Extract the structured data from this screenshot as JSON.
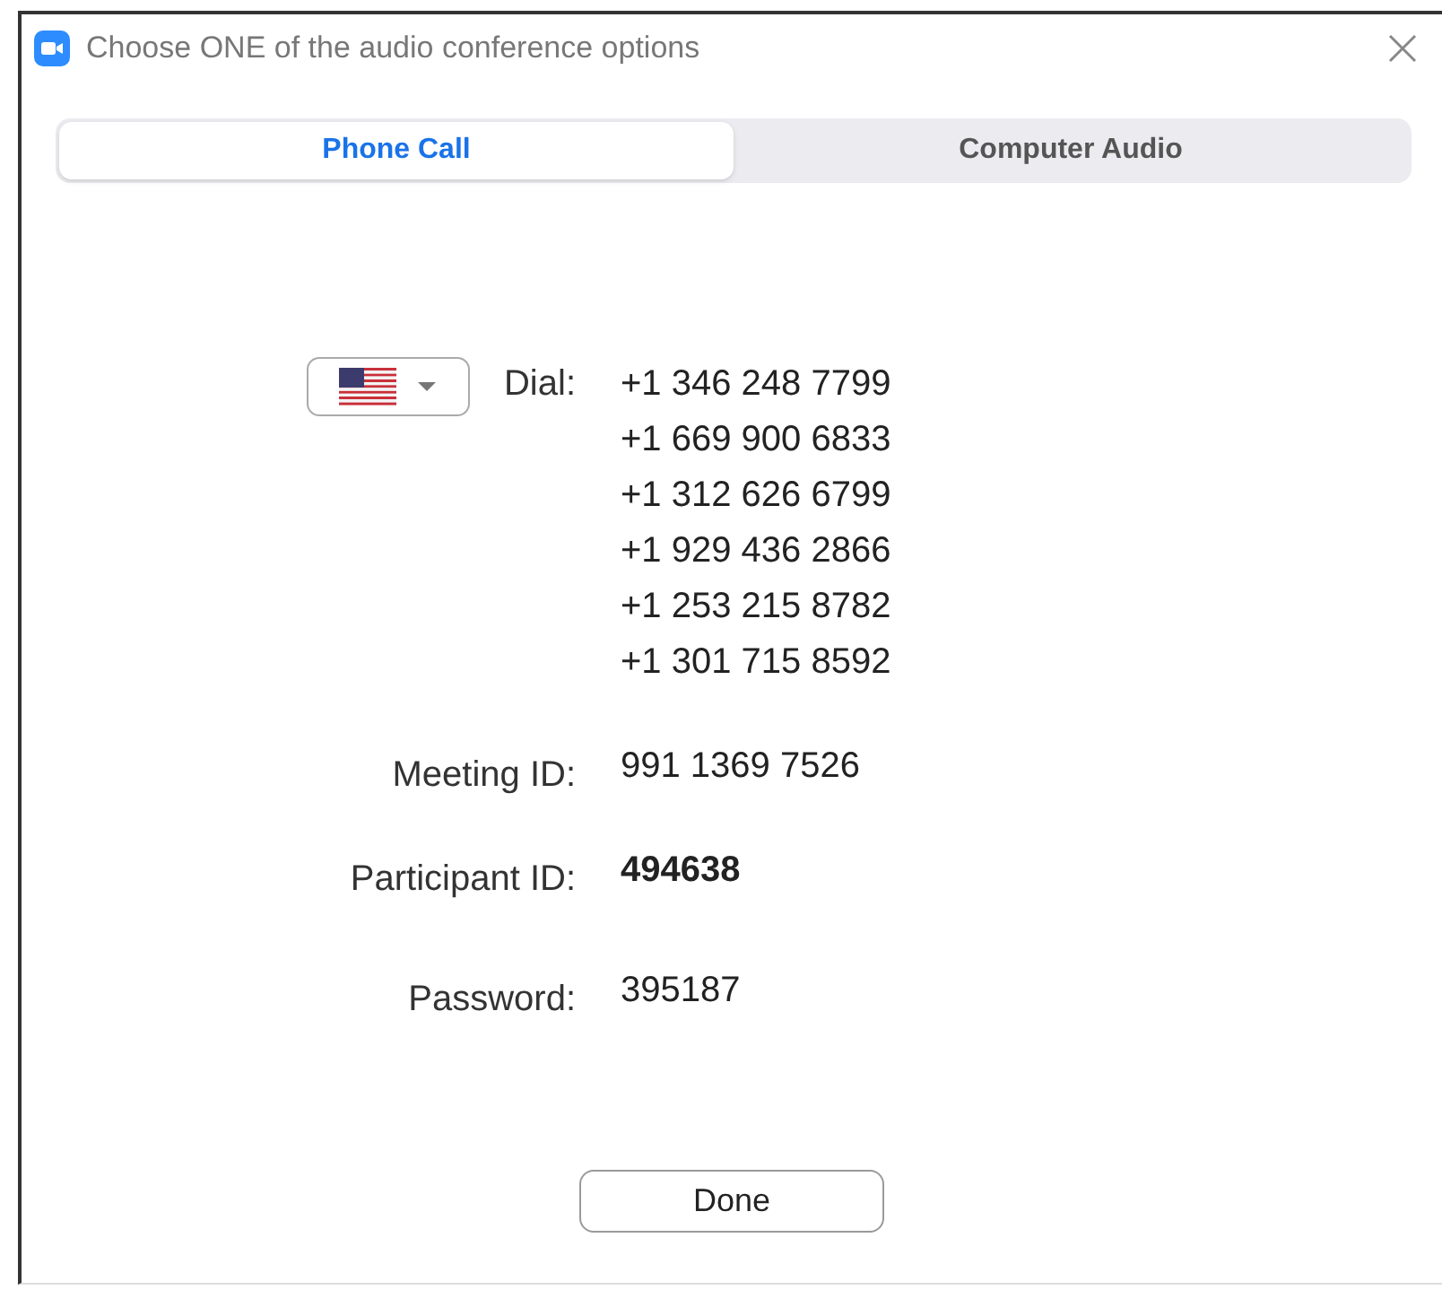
{
  "window": {
    "title": "Choose ONE of the audio conference options"
  },
  "tabs": [
    {
      "label": "Phone Call",
      "selected": true
    },
    {
      "label": "Computer Audio",
      "selected": false
    }
  ],
  "dial": {
    "label": "Dial:",
    "numbers": [
      "+1 346 248 7799",
      "+1 669 900 6833",
      "+1 312 626 6799",
      "+1 929 436 2866",
      "+1 253 215 8782",
      "+1 301 715 8592"
    ]
  },
  "fields": [
    {
      "label": "Meeting ID:",
      "value": "991 1369 7526",
      "bold": false
    },
    {
      "label": "Participant ID:",
      "value": "494638",
      "bold": true
    },
    {
      "label": "Password:",
      "value": "395187",
      "bold": false
    }
  ],
  "done_button": "Done"
}
